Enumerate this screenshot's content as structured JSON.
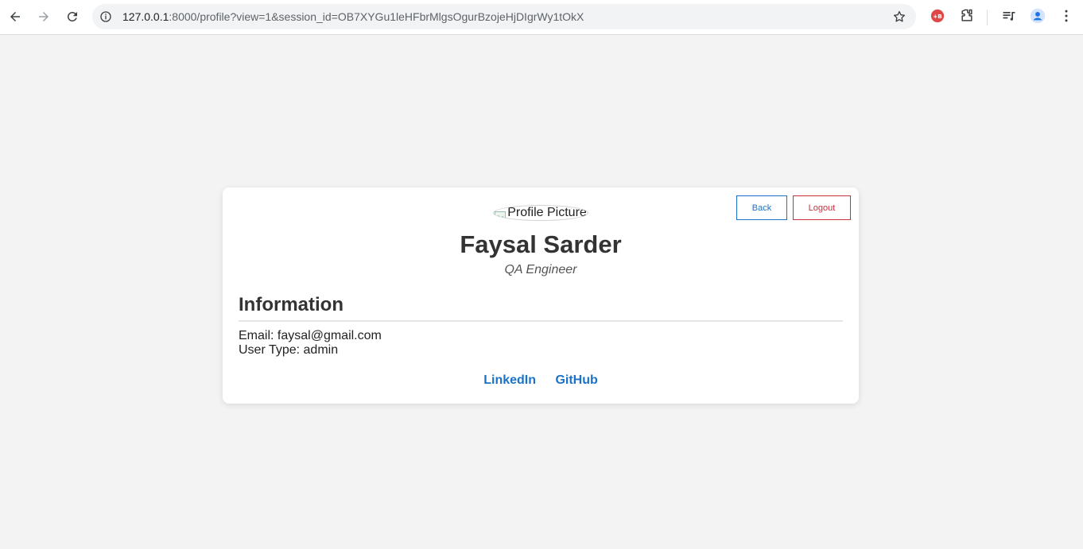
{
  "browser": {
    "url_host": "127.0.0.1",
    "url_rest": ":8000/profile?view=1&session_id=OB7XYGu1leHFbrMlgsOgurBzojeHjDIgrWy1tOkX",
    "icons": [
      "back-arrow-icon",
      "forward-arrow-icon",
      "reload-icon",
      "site-info-icon",
      "bookmark-star-icon",
      "extension-badge-icon",
      "extensions-puzzle-icon",
      "media-control-icon",
      "profile-avatar-icon",
      "more-menu-icon"
    ]
  },
  "profile": {
    "picture_alt": "Profile Picture",
    "name": "Faysal Sarder",
    "role": "QA Engineer",
    "back_label": "Back",
    "logout_label": "Logout",
    "section_title": "Information",
    "email_line": "Email: faysal@gmail.com",
    "user_type_line": "User Type: admin",
    "links": {
      "linkedin": "LinkedIn",
      "github": "GitHub"
    }
  },
  "colors": {
    "page_bg": "#f3f3f3",
    "accent_blue": "#1a73c8",
    "logout_red": "#c8323c",
    "text_dark": "#333333"
  }
}
